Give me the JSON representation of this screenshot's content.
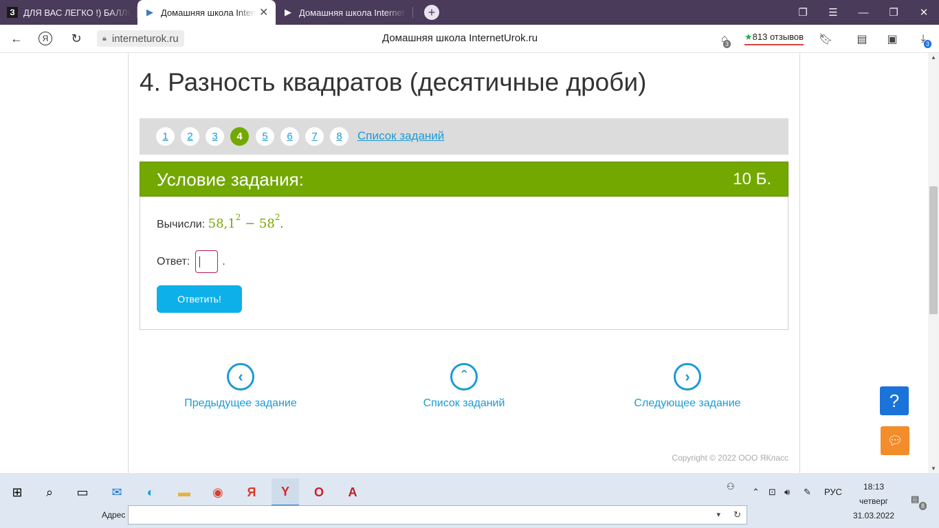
{
  "browser": {
    "tabs": [
      {
        "favicon": "З",
        "label": "ДЛЯ ВАС ЛЕГКО !) БАЛЛО"
      },
      {
        "favicon": "▶",
        "label": "Домашняя школа Interr"
      },
      {
        "favicon": "▶",
        "label": "Домашняя школа Internet"
      }
    ],
    "url": "interneturok.ru",
    "page_title": "Домашняя школа InternetUrok.ru",
    "reviews": "813 отзывов",
    "badges": {
      "protect": "3",
      "downloads": "3"
    }
  },
  "page": {
    "heading": "4. Разность квадратов (десятичные дроби)",
    "task_numbers": [
      "1",
      "2",
      "3",
      "4",
      "5",
      "6",
      "7",
      "8"
    ],
    "active_task": "4",
    "task_list_link": "Список заданий",
    "condition_title": "Условие задания:",
    "points": "10 Б.",
    "task_prompt": "Вычисли:",
    "math": {
      "base1": "58,1",
      "exp1": "2",
      "op": "−",
      "base2": "58",
      "exp2": "2",
      "tail": "."
    },
    "answer_label": "Ответ:",
    "answer_tail": ".",
    "submit_label": "Ответить!",
    "nav": {
      "prev": "Предыдущее задание",
      "list": "Список заданий",
      "next": "Следующее задание"
    },
    "copyright": "Copyright © 2022 ООО ЯКласс",
    "help_label": "?"
  },
  "taskbar": {
    "address_label": "Адрес",
    "lang": "РУС",
    "time": "18:13",
    "day": "четверг",
    "date": "31.03.2022",
    "notif_count": "8"
  }
}
